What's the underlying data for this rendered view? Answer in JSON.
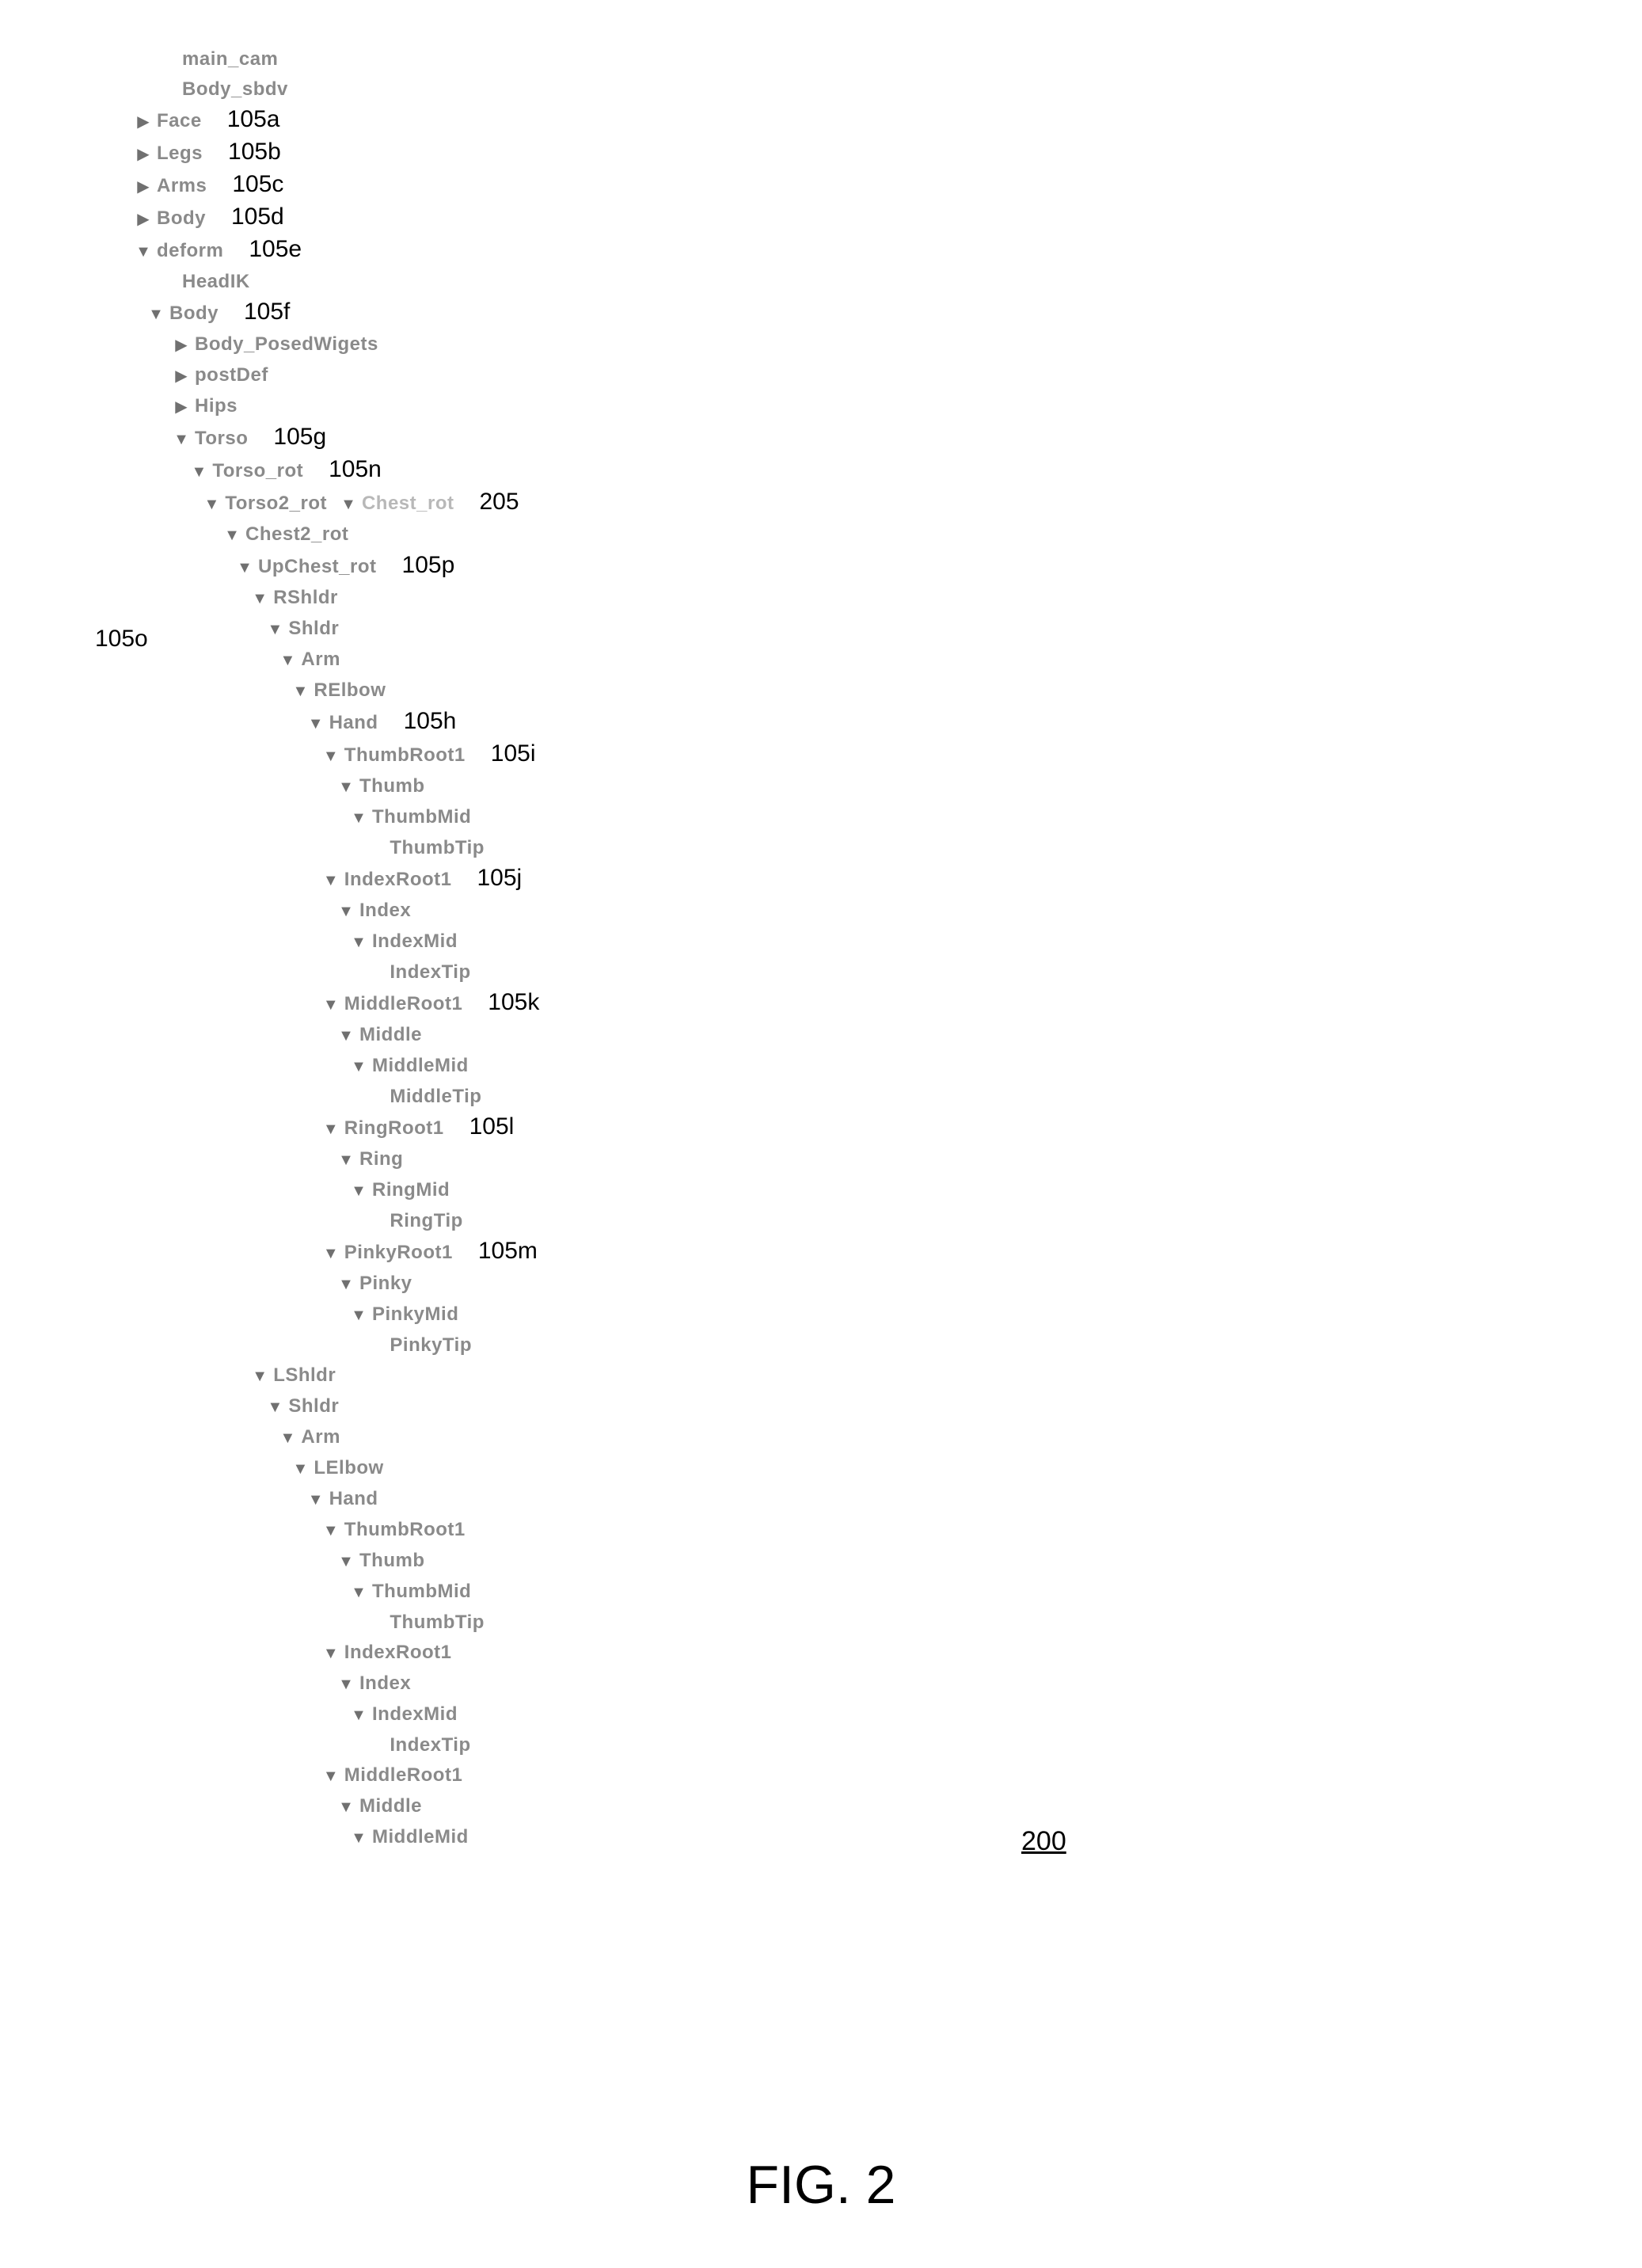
{
  "figure": {
    "caption": "FIG. 2",
    "ref": "200"
  },
  "annotations": {
    "a105a": "105a",
    "a105b": "105b",
    "a105c": "105c",
    "a105d": "105d",
    "a105e": "105e",
    "a105f": "105f",
    "a105g": "105g",
    "a105h": "105h",
    "a105i": "105i",
    "a105j": "105j",
    "a105k": "105k",
    "a105l": "105l",
    "a105m": "105m",
    "a105n": "105n",
    "a105o": "105o",
    "a105p": "105p",
    "a205": "205"
  },
  "tree": [
    {
      "id": "main_cam",
      "label": "main_cam",
      "depth": 1,
      "arrow": "none"
    },
    {
      "id": "body_sbdv",
      "label": "Body_sbdv",
      "depth": 1,
      "arrow": "none"
    },
    {
      "id": "face",
      "label": "Face",
      "depth": 0,
      "arrow": "right",
      "annot": "a105a"
    },
    {
      "id": "legs",
      "label": "Legs",
      "depth": 0,
      "arrow": "right",
      "annot": "a105b"
    },
    {
      "id": "arms",
      "label": "Arms",
      "depth": 0,
      "arrow": "right",
      "annot": "a105c"
    },
    {
      "id": "body_top",
      "label": "Body",
      "depth": 0,
      "arrow": "right",
      "annot": "a105d"
    },
    {
      "id": "deform",
      "label": "deform",
      "depth": 0,
      "arrow": "down",
      "annot": "a105e"
    },
    {
      "id": "headik",
      "label": "HeadIK",
      "depth": 1,
      "arrow": "none"
    },
    {
      "id": "body_def",
      "label": "Body",
      "depth": 0.5,
      "arrow": "down",
      "annot": "a105f"
    },
    {
      "id": "body_posedwigets",
      "label": "Body_PosedWigets",
      "depth": 1.5,
      "arrow": "right"
    },
    {
      "id": "postdef",
      "label": "postDef",
      "depth": 1.5,
      "arrow": "right"
    },
    {
      "id": "hips",
      "label": "Hips",
      "depth": 1.5,
      "arrow": "right"
    },
    {
      "id": "torso",
      "label": "Torso",
      "depth": 1.5,
      "arrow": "down",
      "annot": "a105g"
    },
    {
      "id": "torso_rot",
      "label": "Torso_rot",
      "depth": 2.2,
      "arrow": "down",
      "annot": "a105n"
    },
    {
      "id": "torso2_rot",
      "label": "Torso2_rot",
      "depth": 2.7,
      "arrow": "down",
      "siblingInline": {
        "id": "chest_rot",
        "label": "Chest_rot",
        "arrow": "down",
        "annot": "a205"
      }
    },
    {
      "id": "chest2_rot",
      "label": "Chest2_rot",
      "depth": 3.5,
      "arrow": "down"
    },
    {
      "id": "upchest_rot",
      "label": "UpChest_rot",
      "depth": 4.0,
      "arrow": "down",
      "annot": "a105p"
    },
    {
      "id": "rshldr",
      "label": "RShldr",
      "depth": 4.6,
      "arrow": "down"
    },
    {
      "id": "r_shldr",
      "label": "Shldr",
      "depth": 5.2,
      "arrow": "down"
    },
    {
      "id": "r_arm",
      "label": "Arm",
      "depth": 5.7,
      "arrow": "down"
    },
    {
      "id": "relbow",
      "label": "RElbow",
      "depth": 6.2,
      "arrow": "down"
    },
    {
      "id": "r_hand",
      "label": "Hand",
      "depth": 6.8,
      "arrow": "down",
      "annot": "a105h"
    },
    {
      "id": "r_thumbroot1",
      "label": "ThumbRoot1",
      "depth": 7.4,
      "arrow": "down",
      "annot": "a105i"
    },
    {
      "id": "r_thumb",
      "label": "Thumb",
      "depth": 8.0,
      "arrow": "down"
    },
    {
      "id": "r_thumbmid",
      "label": "ThumbMid",
      "depth": 8.5,
      "arrow": "down"
    },
    {
      "id": "r_thumbtip",
      "label": "ThumbTip",
      "depth": 9.2,
      "arrow": "none"
    },
    {
      "id": "r_indexroot1",
      "label": "IndexRoot1",
      "depth": 7.4,
      "arrow": "down",
      "annot": "a105j"
    },
    {
      "id": "r_index",
      "label": "Index",
      "depth": 8.0,
      "arrow": "down"
    },
    {
      "id": "r_indexmid",
      "label": "IndexMid",
      "depth": 8.5,
      "arrow": "down"
    },
    {
      "id": "r_indextip",
      "label": "IndexTip",
      "depth": 9.2,
      "arrow": "none"
    },
    {
      "id": "r_middleroot1",
      "label": "MiddleRoot1",
      "depth": 7.4,
      "arrow": "down",
      "annot": "a105k"
    },
    {
      "id": "r_middle",
      "label": "Middle",
      "depth": 8.0,
      "arrow": "down"
    },
    {
      "id": "r_middlemid",
      "label": "MiddleMid",
      "depth": 8.5,
      "arrow": "down"
    },
    {
      "id": "r_middletip",
      "label": "MiddleTip",
      "depth": 9.2,
      "arrow": "none"
    },
    {
      "id": "r_ringroot1",
      "label": "RingRoot1",
      "depth": 7.4,
      "arrow": "down",
      "annot": "a105l"
    },
    {
      "id": "r_ring",
      "label": "Ring",
      "depth": 8.0,
      "arrow": "down"
    },
    {
      "id": "r_ringmid",
      "label": "RingMid",
      "depth": 8.5,
      "arrow": "down"
    },
    {
      "id": "r_ringtip",
      "label": "RingTip",
      "depth": 9.2,
      "arrow": "none"
    },
    {
      "id": "r_pinkyroot1",
      "label": "PinkyRoot1",
      "depth": 7.4,
      "arrow": "down",
      "annot": "a105m"
    },
    {
      "id": "r_pinky",
      "label": "Pinky",
      "depth": 8.0,
      "arrow": "down"
    },
    {
      "id": "r_pinkymid",
      "label": "PinkyMid",
      "depth": 8.5,
      "arrow": "down"
    },
    {
      "id": "r_pinkytip",
      "label": "PinkyTip",
      "depth": 9.2,
      "arrow": "none"
    },
    {
      "id": "lshldr",
      "label": "LShldr",
      "depth": 4.6,
      "arrow": "down"
    },
    {
      "id": "l_shldr",
      "label": "Shldr",
      "depth": 5.2,
      "arrow": "down"
    },
    {
      "id": "l_arm",
      "label": "Arm",
      "depth": 5.7,
      "arrow": "down"
    },
    {
      "id": "lelbow",
      "label": "LElbow",
      "depth": 6.2,
      "arrow": "down"
    },
    {
      "id": "l_hand",
      "label": "Hand",
      "depth": 6.8,
      "arrow": "down"
    },
    {
      "id": "l_thumbroot1",
      "label": "ThumbRoot1",
      "depth": 7.4,
      "arrow": "down"
    },
    {
      "id": "l_thumb",
      "label": "Thumb",
      "depth": 8.0,
      "arrow": "down"
    },
    {
      "id": "l_thumbmid",
      "label": "ThumbMid",
      "depth": 8.5,
      "arrow": "down"
    },
    {
      "id": "l_thumbtip",
      "label": "ThumbTip",
      "depth": 9.2,
      "arrow": "none"
    },
    {
      "id": "l_indexroot1",
      "label": "IndexRoot1",
      "depth": 7.4,
      "arrow": "down"
    },
    {
      "id": "l_index",
      "label": "Index",
      "depth": 8.0,
      "arrow": "down"
    },
    {
      "id": "l_indexmid",
      "label": "IndexMid",
      "depth": 8.5,
      "arrow": "down"
    },
    {
      "id": "l_indextip",
      "label": "IndexTip",
      "depth": 9.2,
      "arrow": "none"
    },
    {
      "id": "l_middleroot1",
      "label": "MiddleRoot1",
      "depth": 7.4,
      "arrow": "down"
    },
    {
      "id": "l_middle",
      "label": "Middle",
      "depth": 8.0,
      "arrow": "down"
    },
    {
      "id": "l_middlemid",
      "label": "MiddleMid",
      "depth": 8.5,
      "arrow": "down"
    }
  ]
}
